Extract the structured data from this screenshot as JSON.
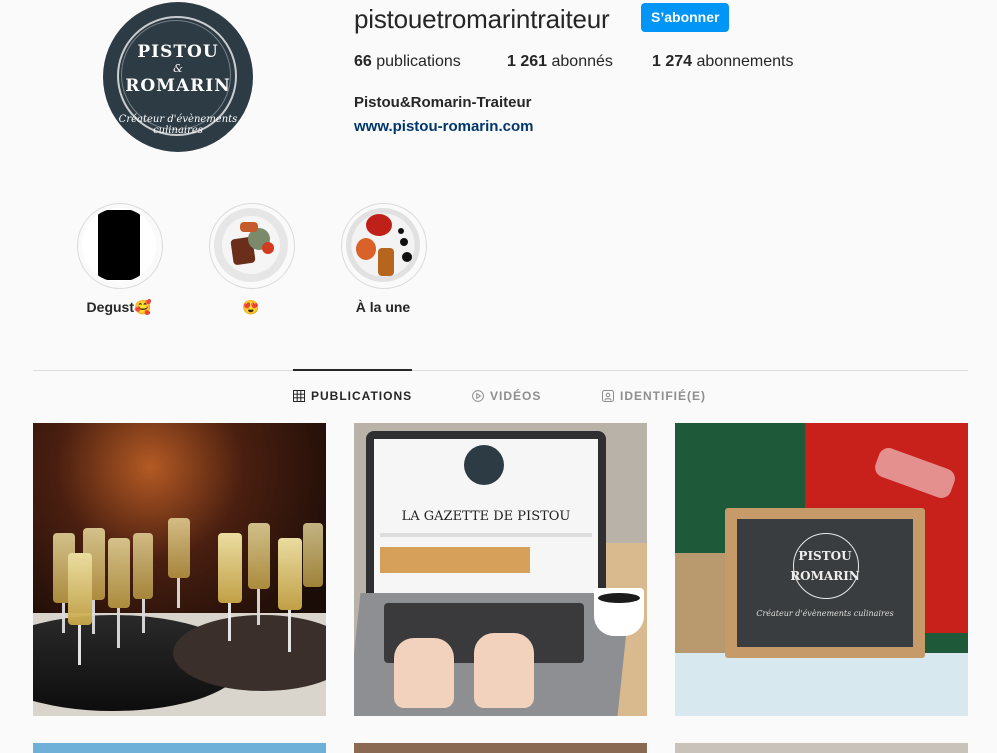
{
  "profile": {
    "username": "pistouetromarintraiteur",
    "follow_label": "S’abonner",
    "full_name": "Pistou&Romarin-Traiteur",
    "website": "www.pistou-romarin.com",
    "avatar": {
      "line1": "PISTOU",
      "amp": "&",
      "line2": "ROMARIN",
      "tagline": "Créateur d'évènements culinaires"
    }
  },
  "stats": {
    "publications": {
      "value": "66",
      "label": "publications"
    },
    "followers": {
      "value": "1 261",
      "label": "abonnés"
    },
    "following": {
      "value": "1 274",
      "label": "abonnements"
    }
  },
  "highlights": [
    {
      "label": "Degust🥰"
    },
    {
      "label": "😍"
    },
    {
      "label": "À la une"
    }
  ],
  "tabs": [
    {
      "label": "PUBLICATIONS",
      "icon": "grid-icon",
      "active": true
    },
    {
      "label": "VIDÉOS",
      "icon": "play-icon",
      "active": false
    },
    {
      "label": "IDENTIFIÉ(E)",
      "icon": "tagged-icon",
      "active": false
    }
  ],
  "posts": {
    "laptop_screen_title": "LA GAZETTE DE PISTOU",
    "chalkboard_line1": "PISTOU",
    "chalkboard_line2": "ROMARIN",
    "chalkboard_tagline": "Créateur d'évènements culinaires"
  },
  "colors": {
    "accent": "#0095f6",
    "link": "#00376b",
    "avatar_bg": "#2d3b45"
  }
}
